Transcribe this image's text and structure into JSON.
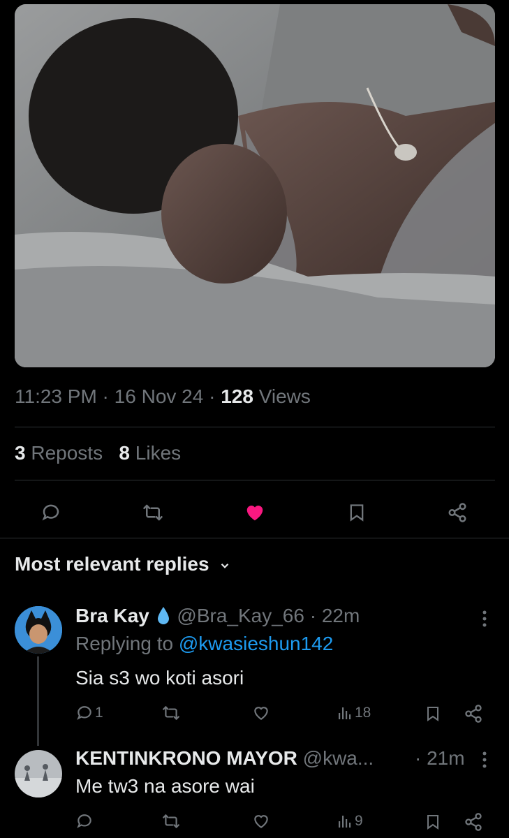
{
  "post": {
    "time": "11:23 PM",
    "date": "16 Nov 24",
    "views_count": "128",
    "views_label": "Views",
    "reposts_count": "3",
    "reposts_label": "Reposts",
    "likes_count": "8",
    "likes_label": "Likes",
    "liked": true,
    "accent_like": "#f91880"
  },
  "replies": {
    "sort_label": "Most relevant replies",
    "items": [
      {
        "name": "Bra Kay",
        "badge_icon": "droplet-icon",
        "handle": "@Bra_Kay_66",
        "time": "22m",
        "replying_prefix": "Replying to",
        "replying_to": "@kwasieshun142",
        "text": "Sia s3 wo koti asori",
        "reply_count": "1",
        "views": "18"
      },
      {
        "name": "KENTINKRONO MAYOR",
        "handle": "@kwa...",
        "time": "21m",
        "text": "Me tw3 na asore wai",
        "views": "9"
      }
    ]
  },
  "colors": {
    "muted": "#71767b",
    "link": "#1d9bf0",
    "text": "#e7e9ea",
    "divider": "#2f3336"
  }
}
